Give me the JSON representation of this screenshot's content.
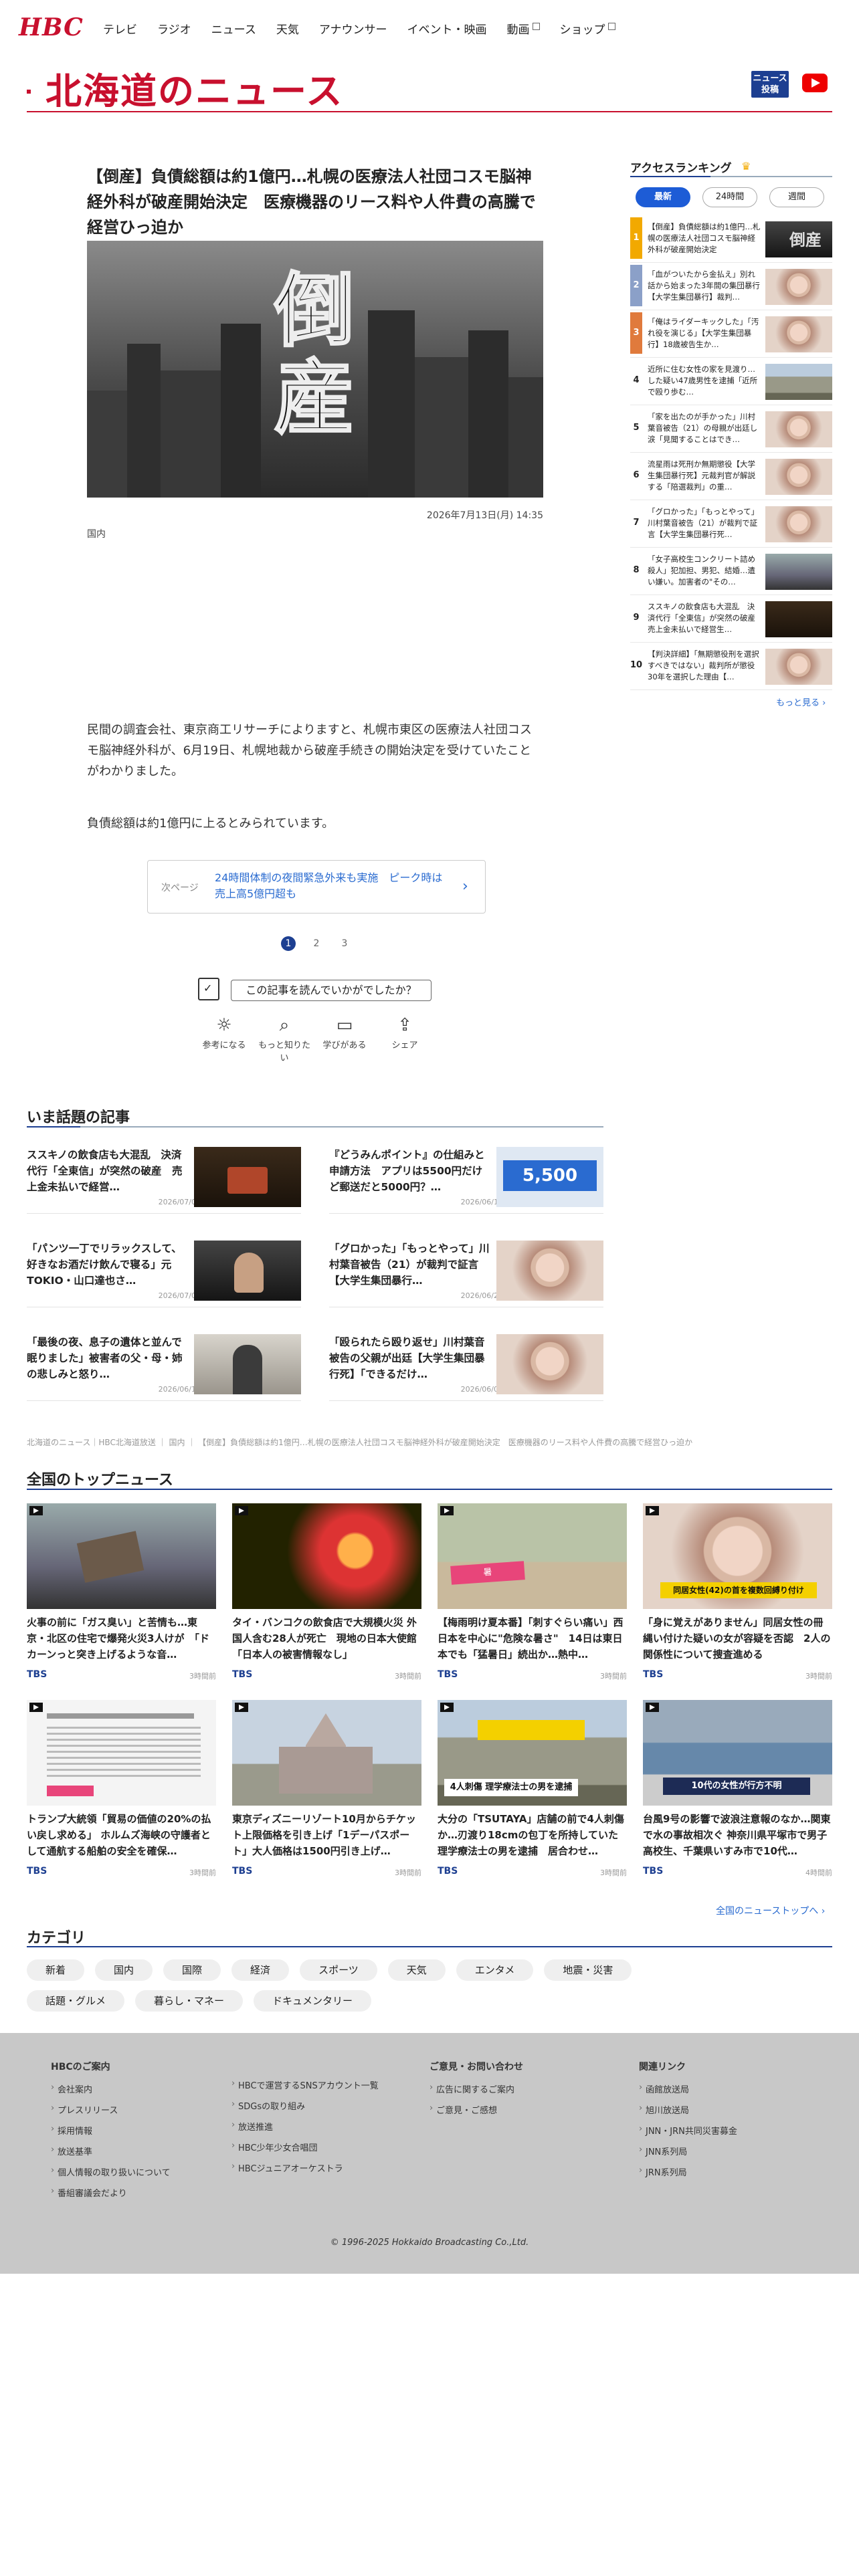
{
  "header": {
    "logo": "HBC",
    "nav": [
      {
        "label": "テレビ",
        "ext": false
      },
      {
        "label": "ラジオ",
        "ext": false
      },
      {
        "label": "ニュース",
        "ext": false
      },
      {
        "label": "天気",
        "ext": false
      },
      {
        "label": "アナウンサー",
        "ext": false
      },
      {
        "label": "イベント・映画",
        "ext": false
      },
      {
        "label": "動画",
        "ext": true
      },
      {
        "label": "ショップ",
        "ext": true
      }
    ],
    "brand_title": "北海道のニュース",
    "news_button": "ニュース\n投稿"
  },
  "article": {
    "headline": "【倒産】負債総額は約1億円…札幌の医療法人社団コスモ脳神経外科が破産開始決定　医療機器のリース料や人件費の高騰で経営ひっ迫か",
    "hero_text": "倒産",
    "date": "2026年7月13日(月) 14:35",
    "category": "国内",
    "body_1": "民間の調査会社、東京商工リサーチによりますと、札幌市東区の医療法人社団コスモ脳神経外科が、6月19日、札幌地裁から破産手続きの開始決定を受けていたことがわかりました。",
    "body_2": "負債総額は約1億円に上るとみられています。",
    "next_label": "次ページ",
    "next_text": "24時間体制の夜間緊急外来も実施　ピーク時は売上高5億円超も",
    "pages": [
      "1",
      "2",
      "3"
    ],
    "survey_button": "この記事を読んでいかがでしたか？",
    "reactions": [
      {
        "icon": "lightbulb-icon",
        "glyph": "☼",
        "label": "参考になる"
      },
      {
        "icon": "search-icon",
        "glyph": "⌕",
        "label": "もっと知りたい"
      },
      {
        "icon": "book-icon",
        "glyph": "▭",
        "label": "学びがある"
      },
      {
        "icon": "share-icon",
        "glyph": "⇪",
        "label": "シェア"
      }
    ]
  },
  "trending": {
    "title": "いま話題の記事",
    "items": [
      {
        "title": "ススキノの飲食店も大混乱　決済代行「全東信」が突然の破産　売上金未払いで経営…",
        "date": "2026/07/09"
      },
      {
        "title": "『どうみんポイント』の仕組みと申請方法　アプリは5500円だけど郵送だと5000円？…",
        "date": "2026/06/16"
      },
      {
        "title": "「パンツ一丁でリラックスして、好きなお酒だけ飲んで寝る」元TOKIO・山口達也さ…",
        "date": "2026/07/04"
      },
      {
        "title": "「グロかった」「もっとやって」川村葉音被告（21）が裁判で証言【大学生集団暴行…",
        "date": "2026/06/26"
      },
      {
        "title": "「最後の夜、息子の遺体と並んで眠りました」被害者の父・母・姉の悲しみと怒り…",
        "date": "2026/06/12"
      },
      {
        "title": "「殴られたら殴り返せ」川村葉音被告の父親が出廷【大学生集団暴行死】「できるだけ…",
        "date": "2026/06/03"
      }
    ],
    "thumb_labels": {
      "t2": "5,500"
    }
  },
  "breadcrumb": "北海道のニュース｜HBC北海道放送 ｜ 国内 ｜ 【倒産】負債総額は約1億円…札幌の医療法人社団コスモ脳神経外科が破産開始決定　医療機器のリース料や人件費の高騰で経営ひっ迫か",
  "top_news": {
    "title": "全国のトップニュース",
    "items": [
      {
        "title": "火事の前に「ガス臭い」と苦情も…東京・北区の住宅で爆発火災3人けが　「ドカーンっと突き上げるような音…",
        "source": "TBS",
        "time": "3時間前"
      },
      {
        "title": "タイ・バンコクの飲食店で大規模火災 外国人含む28人が死亡　現地の日本大使館「日本人の被害情報なし」",
        "source": "TBS",
        "time": "3時間前"
      },
      {
        "title": "【梅雨明け夏本番】「刺すぐらい痛い」西日本を中心に\"危険な暑さ\"　14日は東日本でも「猛暑日」続出か…熱中…",
        "source": "TBS",
        "time": "3時間前"
      },
      {
        "title": "「身に覚えがありません」同居女性の冊縄い付けた疑いの女が容疑を否認　2人の関係性について捜査進める",
        "source": "TBS",
        "time": "3時間前"
      },
      {
        "title": "トランプ大統領「貿易の価値の20%の払い戻し求める」 ホルムズ海峡の守護者として通航する船舶の安全を確保…",
        "source": "TBS",
        "time": "3時間前"
      },
      {
        "title": "東京ディズニーリゾート10月からチケット上限価格を引き上げ「1デーパスポート」大人価格は1500円引き上げ…",
        "source": "TBS",
        "time": "3時間前"
      },
      {
        "title": "大分の「TSUTAYA」店舗の前で4人刺傷か…刃渡り18cmの包丁を所持していた理学療法士の男を逮捕　居合わせ…",
        "source": "TBS",
        "time": "3時間前"
      },
      {
        "title": "台風9号の影響で波浪注意報のなか…関東で水の事故相次ぐ 神奈川県平塚市で男子高校生、千葉県いすみ市で10代…",
        "source": "TBS",
        "time": "4時間前"
      }
    ],
    "captions": {
      "c3": "同居女性(42)の首を複数回縛り付け",
      "c7": "4人刺傷 理学療法士の男を逮捕",
      "c8": "10代の女性が行方不明"
    },
    "more": "全国のニューストップへ ›"
  },
  "categories": {
    "title": "カテゴリ",
    "items": [
      "新着",
      "国内",
      "国際",
      "経済",
      "スポーツ",
      "天気",
      "エンタメ",
      "地震・災害",
      "話題・グルメ",
      "暮らし・マネー",
      "ドキュメンタリー"
    ]
  },
  "footer": {
    "col1": {
      "head": "HBCのご案内",
      "items": [
        "会社案内",
        "プレスリリース",
        "採用情報",
        "放送基準",
        "個人情報の取り扱いについて",
        "番組審議会だより"
      ]
    },
    "col2": {
      "head": "",
      "items": [
        "HBCで運営するSNSアカウント一覧",
        "SDGsの取り組み",
        "放送推進",
        "HBC少年少女合唱団",
        "HBCジュニアオーケストラ"
      ]
    },
    "col3": {
      "head": "ご意見・お問い合わせ",
      "items": [
        "広告に関するご案内",
        "ご意見・ご感想"
      ]
    },
    "col4": {
      "head": "関連リンク",
      "items": [
        "函館放送局",
        "旭川放送局",
        "JNN・JRN共同災害募金",
        "JNN系列局",
        "JRN系列局"
      ]
    },
    "copyright": "© 1996-2025 Hokkaido Broadcasting Co.,Ltd."
  },
  "ranking": {
    "title": "アクセスランキング",
    "tabs": [
      "最新",
      "24時間",
      "週間"
    ],
    "items": [
      {
        "rank": "1",
        "title": "【倒産】負債総額は約1億円…札幌の医療法人社団コスモ脳神経外科が破産開始決定",
        "color": "#f2a900"
      },
      {
        "rank": "2",
        "title": "「血がついたから金払え」別れ話から始まった3年間の集団暴行【大学生集団暴行】裁判…",
        "color": "#8ba0c8"
      },
      {
        "rank": "3",
        "title": "「俺はライダーキックした」「汚れ役を演じる」【大学生集団暴行】18歳被告生か…",
        "color": "#e07a3c"
      },
      {
        "rank": "4",
        "title": "近所に住む女性の家を見渡り…した疑い47歳男性を逮捕「近所で殴り歩む…",
        "color": ""
      },
      {
        "rank": "5",
        "title": "「家を出たのが手かった」川村葉音被告（21）の母親が出廷し涙「見聞することはでき…",
        "color": ""
      },
      {
        "rank": "6",
        "title": "流星雨は死刑か無期懲役【大学生集団暴行死】元裁判官が解説する「陪選裁判」の重…",
        "color": ""
      },
      {
        "rank": "7",
        "title": "「グロかった」「もっとやって」川村葉音被告（21）が裁判で証言【大学生集団暴行死…",
        "color": ""
      },
      {
        "rank": "8",
        "title": "「女子高校生コンクリート詰め殺人」犯加担、男犯、結婚…遺い嫌い。加害者の\"その…",
        "color": ""
      },
      {
        "rank": "9",
        "title": "ススキノの飲食店も大混乱　決済代行「全東信」が突然の破産　売上金未払いで経営生…",
        "color": ""
      },
      {
        "rank": "10",
        "title": "【判決詳細】「無期懲役刑を選択すべきではない」裁判所が懲役30年を選択した理由【…",
        "color": ""
      }
    ],
    "more": "もっと見る ›"
  },
  "colors": {
    "brand_red": "#c8102e",
    "navy": "#1d3f91",
    "link_blue": "#2a6bd0"
  }
}
